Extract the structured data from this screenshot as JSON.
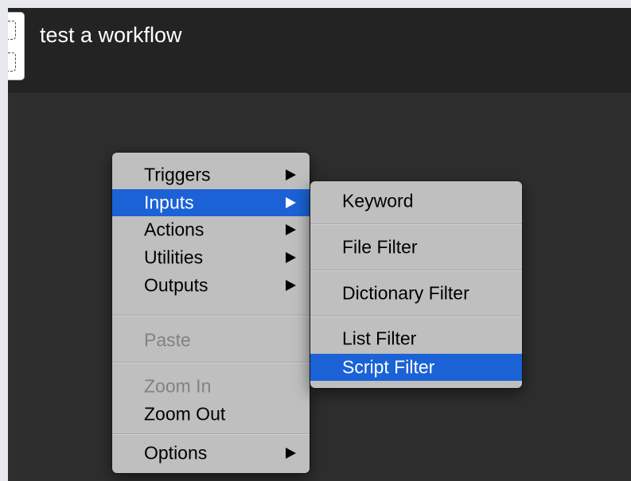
{
  "window": {
    "title": "test a workflow"
  },
  "context_menu": {
    "items": [
      {
        "label": "Triggers",
        "has_submenu": true
      },
      {
        "label": "Inputs",
        "has_submenu": true,
        "selected": true
      },
      {
        "label": "Actions",
        "has_submenu": true
      },
      {
        "label": "Utilities",
        "has_submenu": true
      },
      {
        "label": "Outputs",
        "has_submenu": true
      },
      {
        "label": "Paste",
        "disabled": true
      },
      {
        "label": "Zoom In",
        "disabled": true
      },
      {
        "label": "Zoom Out"
      },
      {
        "label": "Options",
        "has_submenu": true
      }
    ]
  },
  "inputs_submenu": {
    "items": [
      {
        "label": "Keyword"
      },
      {
        "label": "File Filter"
      },
      {
        "label": "Dictionary Filter"
      },
      {
        "label": "List Filter"
      },
      {
        "label": "Script Filter",
        "selected": true
      }
    ]
  },
  "colors": {
    "selection": "#1a62d6",
    "canvas": "#2e2e2e",
    "header": "#232323",
    "menu": "#c4c4c4"
  }
}
